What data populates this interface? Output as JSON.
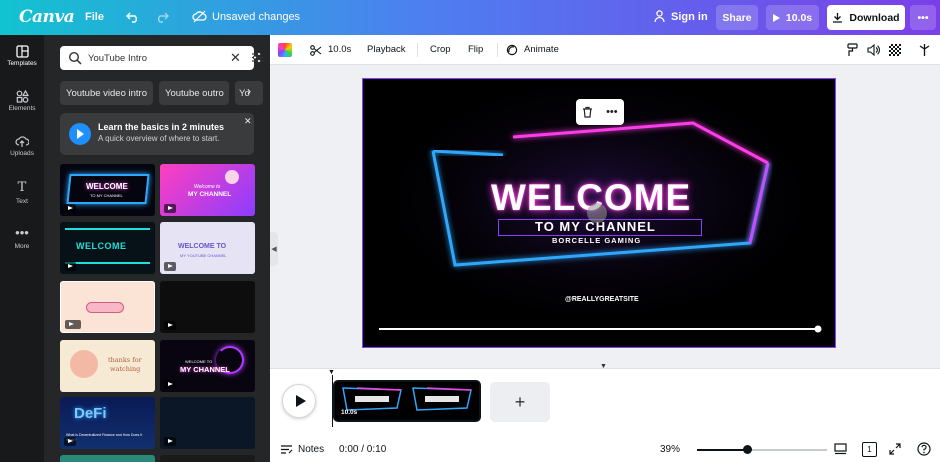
{
  "topbar": {
    "logo": "Canva",
    "file": "File",
    "undo_icon": "undo-icon",
    "redo_icon": "redo-icon",
    "unsaved": "Unsaved changes",
    "sign_in": "Sign in",
    "share": "Share",
    "play_duration": "10.0s",
    "download": "Download",
    "more": "•••"
  },
  "rail": {
    "items": [
      {
        "label": "Templates",
        "icon": "templates-icon"
      },
      {
        "label": "Elements",
        "icon": "elements-icon"
      },
      {
        "label": "Uploads",
        "icon": "uploads-icon"
      },
      {
        "label": "Text",
        "icon": "text-icon"
      },
      {
        "label": "More",
        "icon": "more-icon"
      }
    ]
  },
  "panel": {
    "search_value": "YouTube Intro",
    "chips": [
      "Youtube video intro",
      "Youtube outro",
      "Yo"
    ],
    "promo_title": "Learn the basics in 2 minutes",
    "promo_sub": "A quick overview of where to start.",
    "thumb_texts": {
      "t1": "WELCOME",
      "t1b": "TO MY CHANNEL",
      "t2a": "Welcome to",
      "t2b": "MY CHANNEL",
      "t3": "WELCOME",
      "t4a": "WELCOME TO",
      "t4b": "MY YOUTUBE CHANNEL",
      "t7a": "thanks for",
      "t7b": "watching",
      "t8a": "WELCOME TO",
      "t8b": "MY CHANNEL",
      "t9a": "DeFi",
      "t9b": "What is Decentralized Finance and How Does It Work?"
    }
  },
  "editor_toolbar": {
    "duration": "10.0s",
    "playback": "Playback",
    "crop": "Crop",
    "flip": "Flip",
    "animate": "Animate"
  },
  "canvas": {
    "title": "WELCOME",
    "subtitle": "TO MY CHANNEL",
    "tagline": "BORCELLE GAMING",
    "handle": "@REALLYGREATSITE"
  },
  "timeline": {
    "clip_label": "10.0s"
  },
  "bottom": {
    "notes": "Notes",
    "time": "0:00 / 0:10",
    "zoom": "39%",
    "zoom_fraction": 0.39,
    "page_count": "1"
  },
  "colors": {
    "accent": "#8b3dff",
    "neon_blue": "#2ea8ff",
    "neon_pink": "#ff3ee8"
  }
}
